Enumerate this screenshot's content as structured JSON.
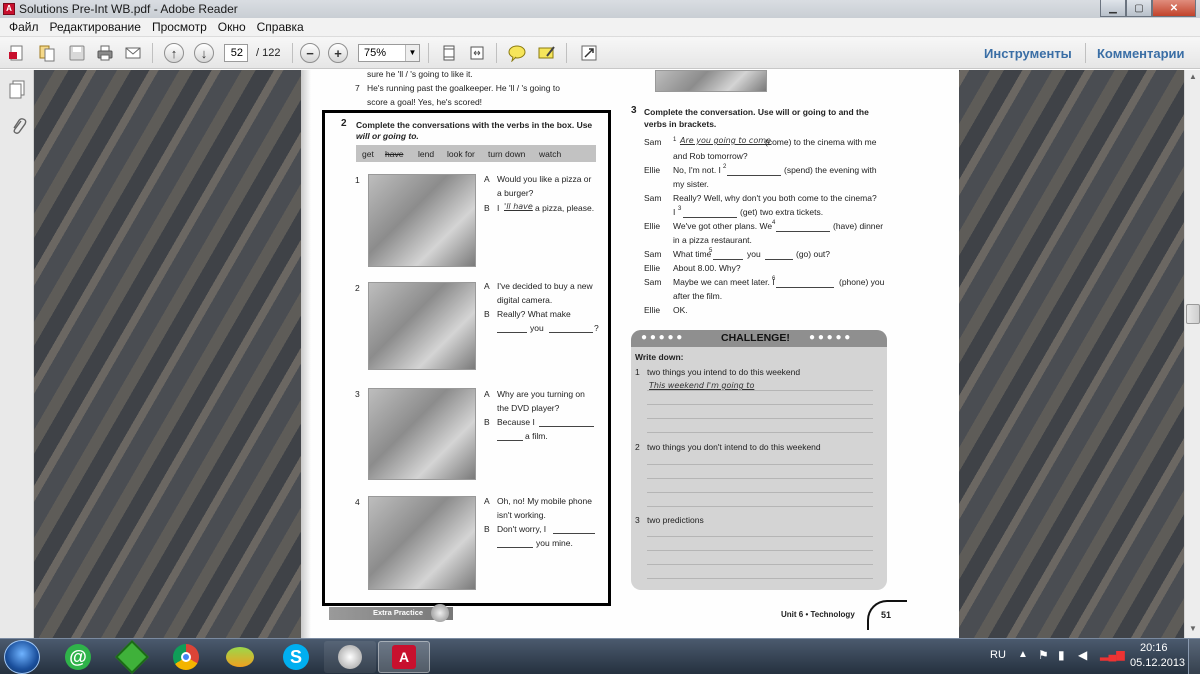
{
  "window": {
    "title": "Solutions Pre-Int WB.pdf - Adobe Reader",
    "app_icon": "pdf-app-icon"
  },
  "menu": [
    "Файл",
    "Редактирование",
    "Просмотр",
    "Окно",
    "Справка"
  ],
  "toolbar": {
    "page_current": "52",
    "page_total": "/ 122",
    "zoom": "75%",
    "tools_label": "Инструменты",
    "comments_label": "Комментарии"
  },
  "doc": {
    "top_lines": [
      "sure he 'll / 's going to like it.",
      "He's running past the goalkeeper. He 'll / 's going to",
      "score a goal! Yes, he's scored!"
    ],
    "top_num7": "7",
    "ex2": {
      "num": "2",
      "instr1": "Complete the conversations with the verbs in the box. Use",
      "instr2": "will or going to.",
      "box": [
        "get",
        "have",
        "lend",
        "look for",
        "turn down",
        "watch"
      ],
      "items": [
        {
          "n": "1",
          "a": [
            "Would you like a pizza or",
            "a burger?"
          ],
          "b_pre": "I",
          "b_fill": "'ll have",
          "b_post": "a pizza, please."
        },
        {
          "n": "2",
          "a": [
            "I've decided to buy a new",
            "digital camera."
          ],
          "b": [
            "Really? What make",
            "you"
          ],
          "q": "?"
        },
        {
          "n": "3",
          "a": [
            "Why are you turning on",
            "the DVD player?"
          ],
          "b": [
            "Because I",
            "a film."
          ]
        },
        {
          "n": "4",
          "a": [
            "Oh, no! My mobile phone",
            "isn't working."
          ],
          "b": [
            "Don't worry, I",
            "you mine."
          ]
        }
      ],
      "labels": {
        "A": "A",
        "B": "B"
      }
    },
    "ex3": {
      "num": "3",
      "instr1": "Complete the conversation. Use will or going to and the",
      "instr2": "verbs in brackets.",
      "lines": [
        {
          "sp": "Sam",
          "t1": "1",
          "fill": "Are you going to come",
          "t2": "(come) to the cinema with me",
          "t3": "and Rob tomorrow?"
        },
        {
          "sp": "Ellie",
          "t1": "No, I'm not. I",
          "sup": "2",
          "t2": "(spend) the evening with",
          "t3": "my sister."
        },
        {
          "sp": "Sam",
          "t1": "Really? Well, why don't you both come to the cinema?",
          "t2": "I",
          "sup": "3",
          "t3": "(get) two extra tickets."
        },
        {
          "sp": "Ellie",
          "t1": "We've got other plans. We",
          "sup": "4",
          "t2": "(have) dinner",
          "t3": "in a pizza restaurant."
        },
        {
          "sp": "Sam",
          "t1": "What time",
          "sup": "5",
          "t2": "you",
          "t3": "(go) out?"
        },
        {
          "sp": "Ellie",
          "t1": "About 8.00. Why?"
        },
        {
          "sp": "Sam",
          "t1": "Maybe we can meet later. I",
          "sup": "6",
          "t2": "(phone) you",
          "t3": "after the film."
        },
        {
          "sp": "Ellie",
          "t1": "OK."
        }
      ]
    },
    "challenge": {
      "title": "CHALLENGE!",
      "write": "Write down:",
      "items": [
        {
          "n": "1",
          "t": "two things you intend to do this weekend",
          "fill": "This weekend I'm going to"
        },
        {
          "n": "2",
          "t": "two things you don't intend to do this weekend"
        },
        {
          "n": "3",
          "t": "two predictions"
        }
      ]
    },
    "footer_left": "Extra Practice",
    "footer_right": "Unit 6 • Technology",
    "page_no": "51"
  },
  "taskbar": {
    "lang": "RU",
    "time": "20:16",
    "date": "05.12.2013"
  }
}
